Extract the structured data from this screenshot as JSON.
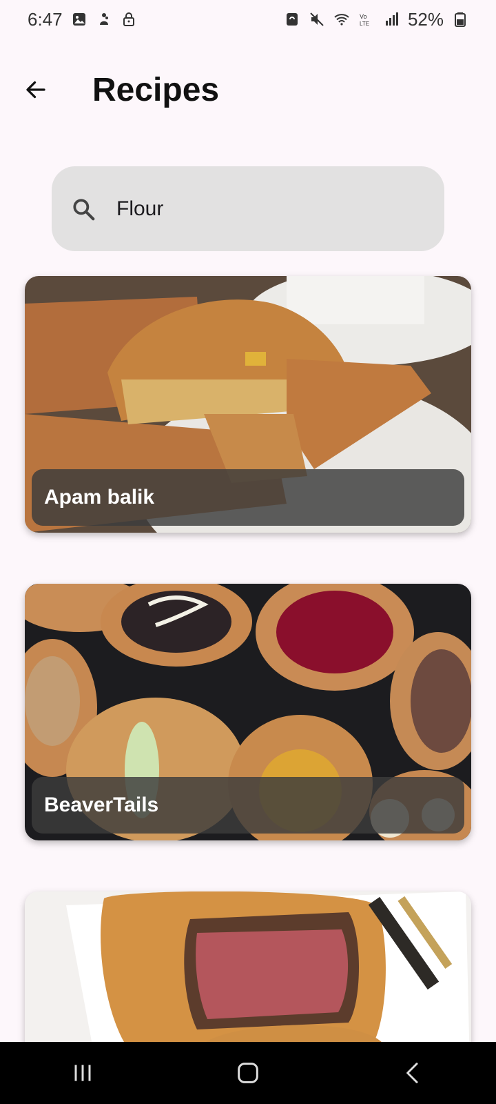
{
  "status_bar": {
    "time": "6:47",
    "battery": "52%",
    "icons": [
      "image-icon",
      "assistant-icon",
      "lock-icon",
      "sync-icon",
      "mute-icon",
      "wifi-icon",
      "volte-icon",
      "signal-icon",
      "battery-icon"
    ]
  },
  "app_bar": {
    "title": "Recipes",
    "back_icon": "arrow-back-icon"
  },
  "search": {
    "value": "Flour",
    "icon": "search-icon"
  },
  "recipes": [
    {
      "name": "Apam balik"
    },
    {
      "name": "BeaverTails"
    },
    {
      "name": ""
    }
  ],
  "nav_bar": {
    "icons": [
      "recents-icon",
      "home-icon",
      "back-icon"
    ]
  },
  "colors": {
    "background": "#fdf7fb",
    "search_background": "#e2e1e1",
    "label_overlay": "#3c3c3c",
    "nav_background": "#000000"
  }
}
